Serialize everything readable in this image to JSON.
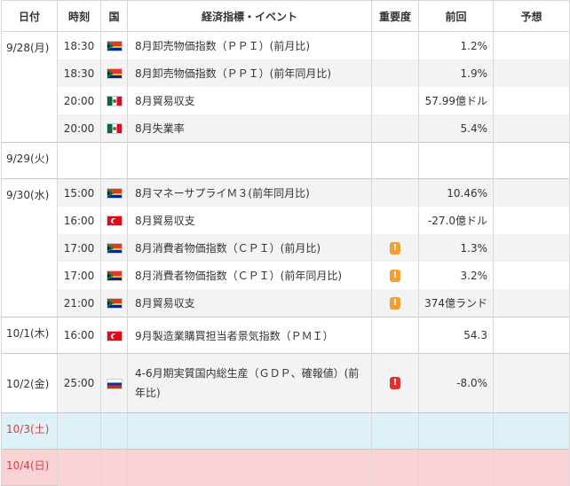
{
  "headers": {
    "date": "日付",
    "time": "時刻",
    "country": "国",
    "event": "経済指標・イベント",
    "importance": "重要度",
    "previous": "前回",
    "forecast": "予想"
  },
  "days": [
    {
      "date": "9/28(月)",
      "rows": [
        {
          "time": "18:30",
          "flag": "south-africa-flag",
          "event": "8月卸売物価指数（ＰＰＩ）(前月比)",
          "importance": "",
          "previous": "1.2%",
          "forecast": ""
        },
        {
          "time": "18:30",
          "flag": "south-africa-flag",
          "event": "8月卸売物価指数（ＰＰＩ）(前年同月比)",
          "importance": "",
          "previous": "1.9%",
          "forecast": ""
        },
        {
          "time": "20:00",
          "flag": "mexico-flag",
          "event": "8月貿易収支",
          "importance": "",
          "previous": "57.99億ドル",
          "forecast": ""
        },
        {
          "time": "20:00",
          "flag": "mexico-flag",
          "event": "8月失業率",
          "importance": "",
          "previous": "5.4%",
          "forecast": ""
        }
      ]
    },
    {
      "date": "9/29(火)",
      "rows": [
        {
          "time": "",
          "flag": "",
          "event": "",
          "importance": "",
          "previous": "",
          "forecast": ""
        }
      ]
    },
    {
      "date": "9/30(水)",
      "rows": [
        {
          "time": "15:00",
          "flag": "south-africa-flag",
          "event": "8月マネーサプライＭ３(前年同月比)",
          "importance": "",
          "previous": "10.46%",
          "forecast": ""
        },
        {
          "time": "16:00",
          "flag": "turkey-flag",
          "event": "8月貿易収支",
          "importance": "",
          "previous": "-27.0億ドル",
          "forecast": ""
        },
        {
          "time": "17:00",
          "flag": "south-africa-flag",
          "event": "8月消費者物価指数（ＣＰＩ）(前月比)",
          "importance": "orange",
          "previous": "1.3%",
          "forecast": ""
        },
        {
          "time": "17:00",
          "flag": "south-africa-flag",
          "event": "8月消費者物価指数（ＣＰＩ）(前年同月比)",
          "importance": "orange",
          "previous": "3.2%",
          "forecast": ""
        },
        {
          "time": "21:00",
          "flag": "south-africa-flag",
          "event": "8月貿易収支",
          "importance": "orange",
          "previous": "374億ランド",
          "forecast": ""
        }
      ]
    },
    {
      "date": "10/1(木)",
      "rows": [
        {
          "time": "16:00",
          "flag": "turkey-flag",
          "event": "9月製造業購買担当者景気指数（ＰＭＩ）",
          "importance": "",
          "previous": "54.3",
          "forecast": ""
        }
      ]
    },
    {
      "date": "10/2(金)",
      "rows": [
        {
          "time": "25:00",
          "flag": "russia-flag",
          "event": "4-6月期実質国内総生産（ＧＤＰ、確報値）(前年比)",
          "importance": "red",
          "previous": "-8.0%",
          "forecast": ""
        }
      ]
    },
    {
      "date": "10/3(土)",
      "rows": [
        {
          "time": "",
          "flag": "",
          "event": "",
          "importance": "",
          "previous": "",
          "forecast": ""
        }
      ]
    },
    {
      "date": "10/4(日)",
      "rows": [
        {
          "time": "",
          "flag": "",
          "event": "",
          "importance": "",
          "previous": "",
          "forecast": ""
        }
      ]
    }
  ],
  "importance_mark": "!",
  "colors": {
    "importance_orange": "#f0a030",
    "importance_red": "#e03030",
    "saturday_bg": "#dff1f8",
    "sunday_bg": "#f9d2d6",
    "weekend_text": "#d04040"
  }
}
